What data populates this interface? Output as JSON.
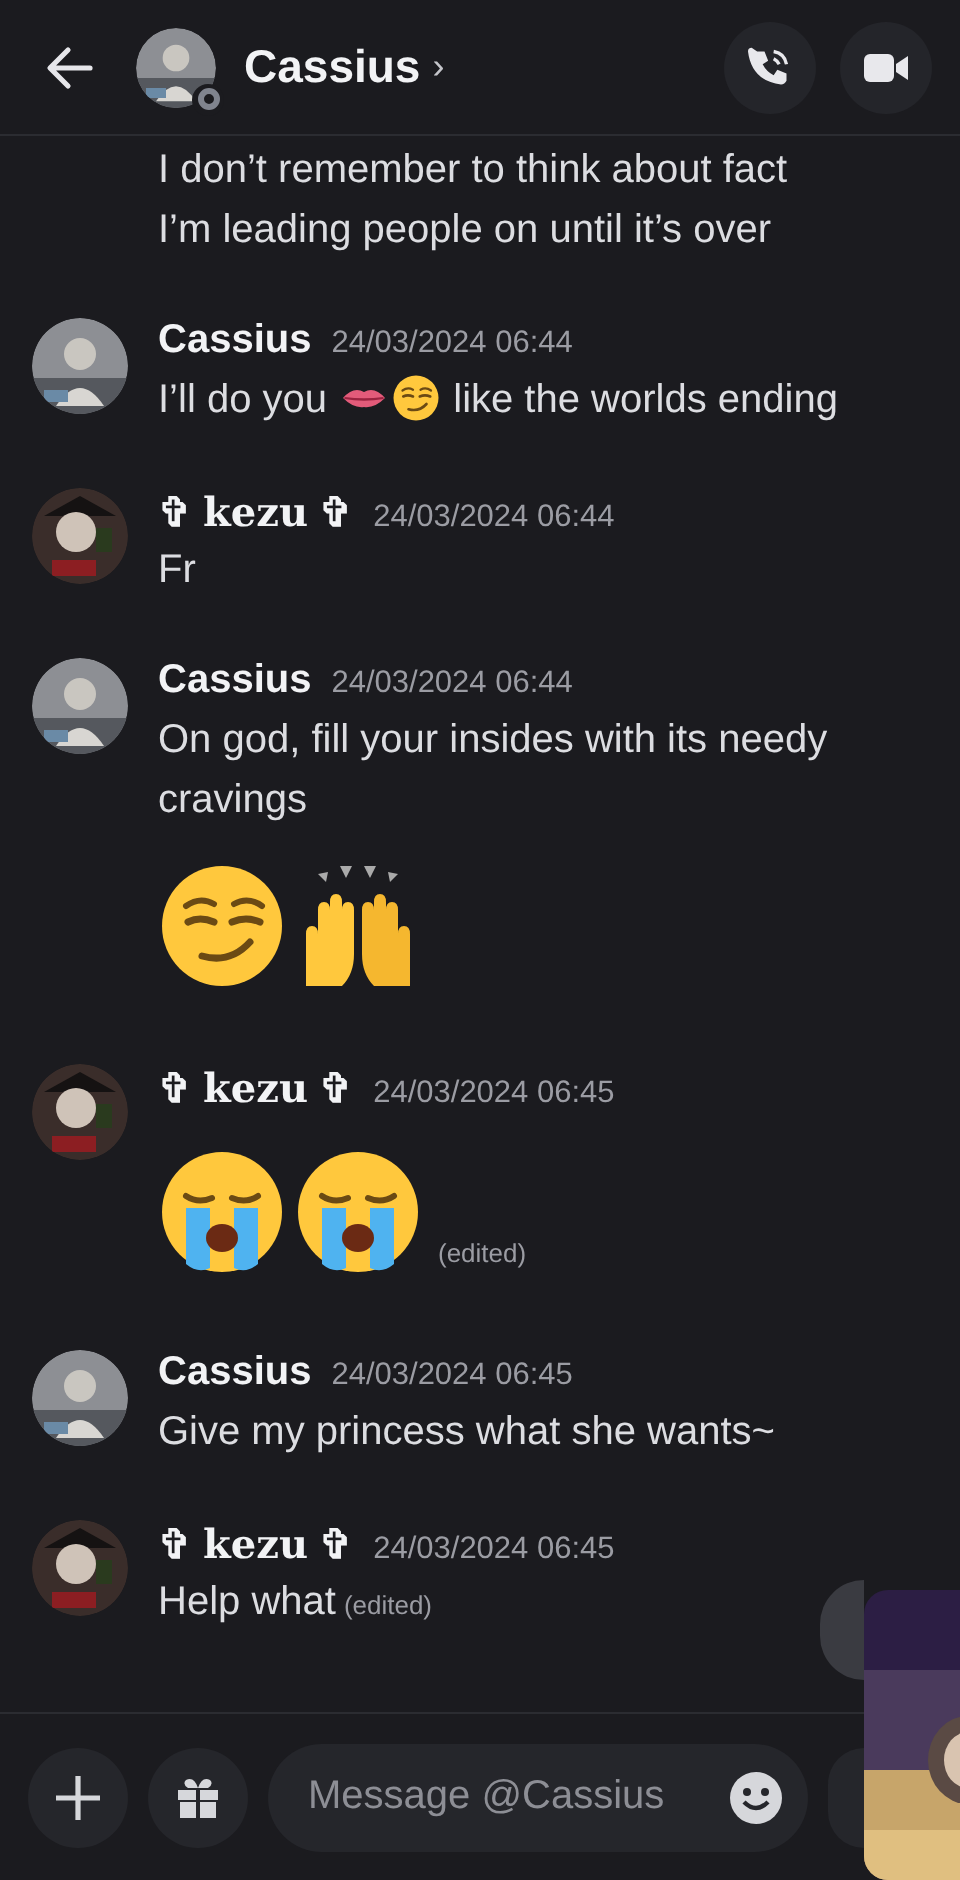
{
  "header": {
    "name": "Cassius",
    "chevron": "›",
    "status": {
      "kind": "offline"
    }
  },
  "messages": [
    {
      "kind": "continuation",
      "blocks": [
        {
          "kind": "text",
          "parts": [
            {
              "kind": "text",
              "text": "I don’t remember to think about fact"
            }
          ]
        },
        {
          "kind": "text",
          "parts": [
            {
              "kind": "text",
              "text": "I’m leading people on until it’s over"
            }
          ]
        }
      ]
    },
    {
      "kind": "message",
      "author": "Cassius",
      "time": "24/03/2024 06:44",
      "blocks": [
        {
          "kind": "text",
          "parts": [
            {
              "kind": "text",
              "text": "I’ll do you "
            },
            {
              "kind": "lips"
            },
            {
              "kind": "smirk"
            },
            {
              "kind": "text",
              "text": "  like the worlds ending"
            }
          ]
        }
      ]
    },
    {
      "kind": "message",
      "author": "✞ 𝐤𝐞𝐳𝐮 ✞",
      "time": "24/03/2024 06:44",
      "blocks": [
        {
          "kind": "text",
          "parts": [
            {
              "kind": "text",
              "text": "Fr"
            }
          ]
        }
      ]
    },
    {
      "kind": "message",
      "author": "Cassius",
      "time": "24/03/2024 06:44",
      "blocks": [
        {
          "kind": "text",
          "parts": [
            {
              "kind": "text",
              "text": "On god, fill your insides with its needy cravings"
            }
          ]
        },
        {
          "kind": "jumbo",
          "emojis": [
            {
              "kind": "smirk"
            },
            {
              "kind": "raised-hands"
            }
          ]
        }
      ]
    },
    {
      "kind": "message",
      "author": "✞ 𝐤𝐞𝐳𝐮 ✞",
      "time": "24/03/2024 06:45",
      "blocks": [
        {
          "kind": "jumbo",
          "emojis": [
            {
              "kind": "crying"
            },
            {
              "kind": "crying"
            }
          ],
          "edited_label": "(edited)"
        }
      ]
    },
    {
      "kind": "message",
      "author": "Cassius",
      "time": "24/03/2024 06:45",
      "blocks": [
        {
          "kind": "text",
          "parts": [
            {
              "kind": "text",
              "text": "Give my princess what she wants~"
            }
          ]
        }
      ]
    },
    {
      "kind": "message",
      "author": "✞ 𝐤𝐞𝐳𝐮 ✞",
      "time": "24/03/2024 06:45",
      "blocks": [
        {
          "kind": "text",
          "parts": [
            {
              "kind": "text",
              "text": "Help what"
            }
          ],
          "edited_label": "(edited)"
        }
      ]
    }
  ],
  "composer": {
    "placeholder": "Message @Cassius"
  }
}
